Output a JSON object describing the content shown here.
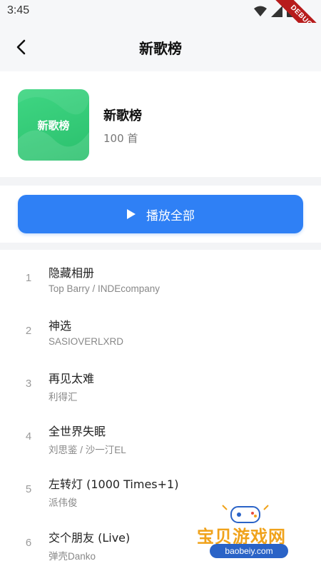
{
  "status_bar": {
    "time": "3:45",
    "debug_label": "DEBUG"
  },
  "app_bar": {
    "title": "新歌榜",
    "back_icon": "chevron-left-icon"
  },
  "playlist": {
    "cover_text": "新歌榜",
    "name": "新歌榜",
    "count": "100 首",
    "cover_color": "#2bc06d"
  },
  "play_all": {
    "label": "播放全部",
    "icon": "play-icon",
    "color": "#2f80f5"
  },
  "songs": [
    {
      "index": "1",
      "title": "隐藏相册",
      "artist": "Top Barry / INDEcompany"
    },
    {
      "index": "2",
      "title": "神选",
      "artist": "SASIOVERLXRD"
    },
    {
      "index": "3",
      "title": "再见太难",
      "artist": "利得汇"
    },
    {
      "index": "4",
      "title": "全世界失眠",
      "artist": "刘思鉴 / 沙一汀EL"
    },
    {
      "index": "5",
      "title": "左转灯 (1000 Times+1)",
      "artist": "派伟俊"
    },
    {
      "index": "6",
      "title": "交个朋友 (Live)",
      "artist": "弹壳Danko"
    }
  ],
  "watermark": {
    "text": "宝贝游戏网",
    "url": "baobeiy.com"
  }
}
